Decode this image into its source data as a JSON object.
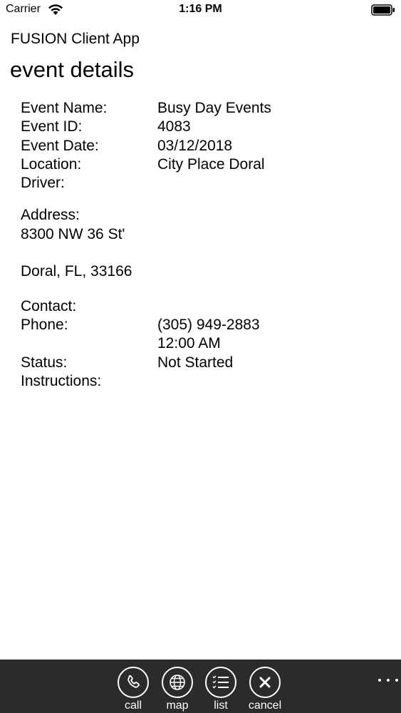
{
  "status_bar": {
    "carrier": "Carrier",
    "time": "1:16 PM"
  },
  "header": {
    "app_title": "FUSION Client App",
    "page_title": "event details"
  },
  "details": {
    "event_name": {
      "label": "Event Name:",
      "value": "Busy Day Events"
    },
    "event_id": {
      "label": "Event ID:",
      "value": "4083"
    },
    "event_date": {
      "label": "Event Date:",
      "value": "03/12/2018"
    },
    "location": {
      "label": "Location:",
      "value": "City Place Doral"
    },
    "driver": {
      "label": "Driver:",
      "value": ""
    },
    "address": {
      "label": "Address:",
      "line1": "8300 NW 36 St'",
      "line2": "Doral, FL, 33166"
    },
    "contact": {
      "label": "Contact:",
      "value": ""
    },
    "phone": {
      "label": "Phone:",
      "value": "(305) 949-2883",
      "time": "12:00 AM"
    },
    "status": {
      "label": "Status:",
      "value": "Not Started"
    },
    "instructions": {
      "label": "Instructions:",
      "value": ""
    }
  },
  "toolbar": {
    "buttons": [
      {
        "label": "call",
        "icon": "phone-icon"
      },
      {
        "label": "map",
        "icon": "globe-icon"
      },
      {
        "label": "list",
        "icon": "list-icon"
      },
      {
        "label": "cancel",
        "icon": "close-icon"
      }
    ],
    "more_icon": "more-icon"
  }
}
